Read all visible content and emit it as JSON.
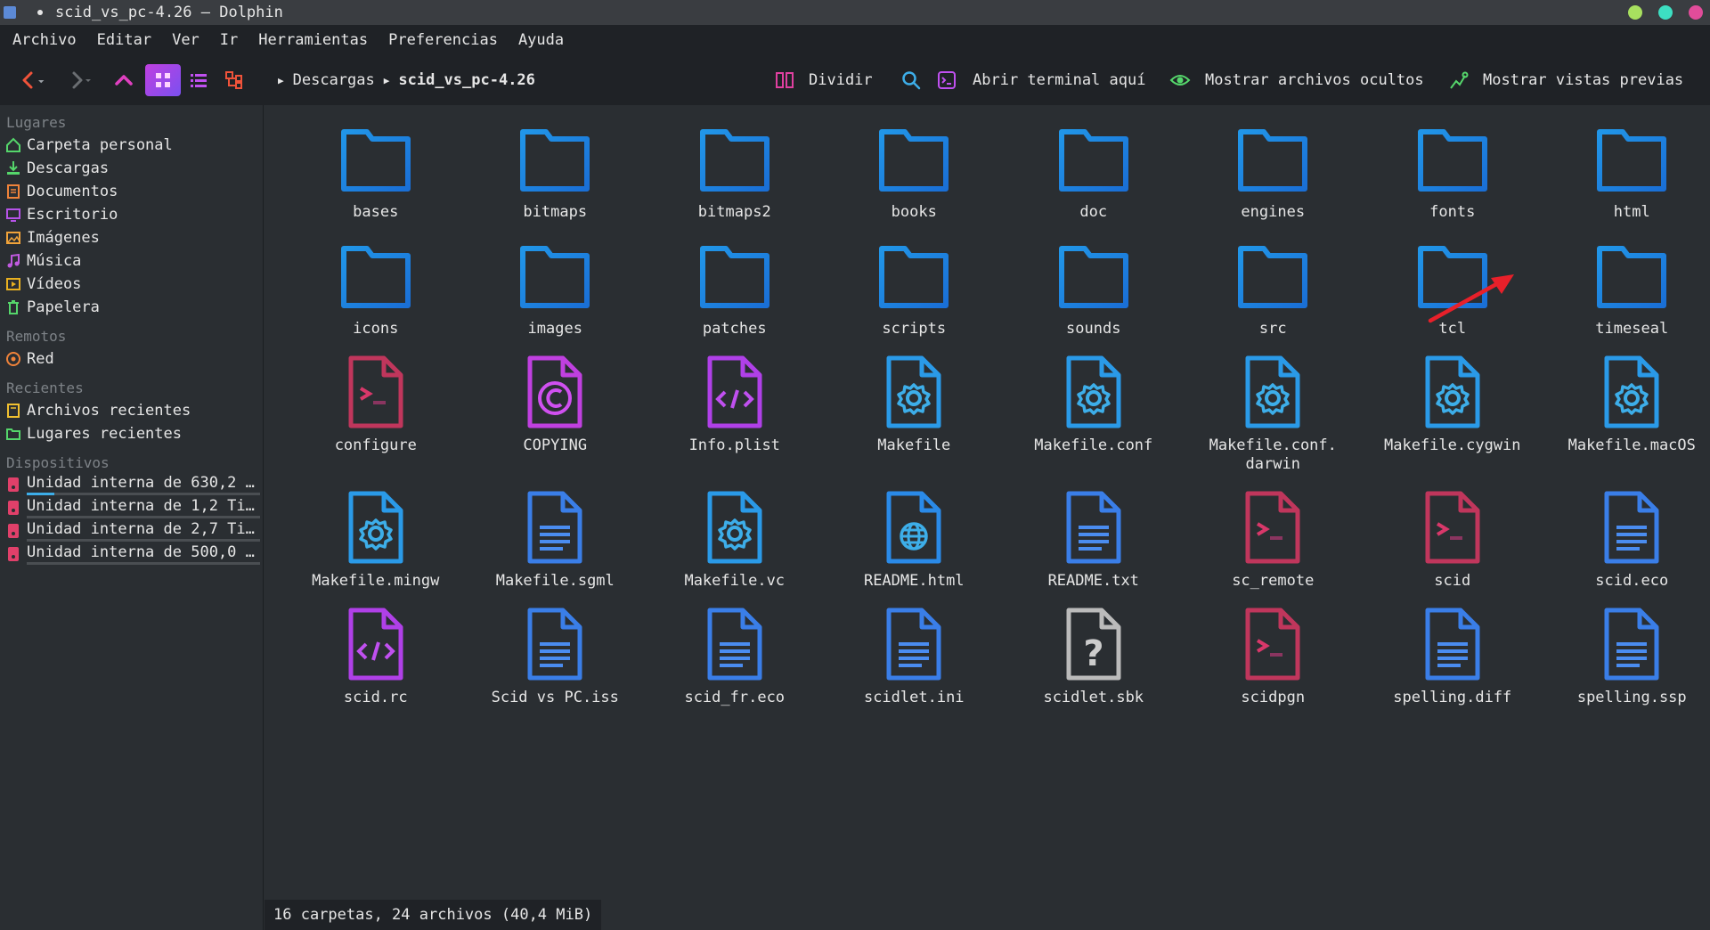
{
  "window": {
    "title": "scid_vs_pc-4.26 — Dolphin",
    "controls": [
      {
        "name": "minimize",
        "color": "#a8e05f"
      },
      {
        "name": "maximize",
        "color": "#3ddfc2"
      },
      {
        "name": "close",
        "color": "#e14c9a"
      }
    ]
  },
  "menu": [
    "Archivo",
    "Editar",
    "Ver",
    "Ir",
    "Herramientas",
    "Preferencias",
    "Ayuda"
  ],
  "toolbar": {
    "breadcrumb": [
      "Descargas",
      "scid_vs_pc-4.26"
    ],
    "split_label": "Dividir",
    "terminal_label": "Abrir terminal aquí",
    "hidden_label": "Mostrar archivos ocultos",
    "previews_label": "Mostrar vistas previas"
  },
  "sidebar": {
    "places_header": "Lugares",
    "places": [
      {
        "label": "Carpeta personal",
        "icon": "home-icon",
        "color": "#55d66b"
      },
      {
        "label": "Descargas",
        "icon": "download-icon",
        "color": "#55d66b"
      },
      {
        "label": "Documentos",
        "icon": "documents-icon",
        "color": "#f0833a"
      },
      {
        "label": "Escritorio",
        "icon": "desktop-icon",
        "color": "#b653e8"
      },
      {
        "label": "Imágenes",
        "icon": "pictures-icon",
        "color": "#f0a33a"
      },
      {
        "label": "Música",
        "icon": "music-icon",
        "color": "#c05ae0"
      },
      {
        "label": "Vídeos",
        "icon": "videos-icon",
        "color": "#e8b020"
      },
      {
        "label": "Papelera",
        "icon": "trash-icon",
        "color": "#55d66b"
      }
    ],
    "remote_header": "Remotos",
    "remote": [
      {
        "label": "Red",
        "icon": "network-icon",
        "color": "#f0833a"
      }
    ],
    "recent_header": "Recientes",
    "recent": [
      {
        "label": "Archivos recientes",
        "icon": "recent-files-icon",
        "color": "#f0c030"
      },
      {
        "label": "Lugares recientes",
        "icon": "recent-places-icon",
        "color": "#55d66b"
      }
    ],
    "devices_header": "Dispositivos",
    "devices": [
      {
        "label": "Unidad interna de 630,2 …",
        "usage": 0.12
      },
      {
        "label": "Unidad interna de 1,2 Ti…",
        "usage": 0.0
      },
      {
        "label": "Unidad interna de 2,7 Ti…",
        "usage": 0.0
      },
      {
        "label": "Unidad interna de 500,0 …",
        "usage": 0.0
      }
    ]
  },
  "files": [
    {
      "name": "bases",
      "type": "folder"
    },
    {
      "name": "bitmaps",
      "type": "folder"
    },
    {
      "name": "bitmaps2",
      "type": "folder"
    },
    {
      "name": "books",
      "type": "folder"
    },
    {
      "name": "doc",
      "type": "folder"
    },
    {
      "name": "engines",
      "type": "folder"
    },
    {
      "name": "fonts",
      "type": "folder"
    },
    {
      "name": "html",
      "type": "folder"
    },
    {
      "name": "icons",
      "type": "folder"
    },
    {
      "name": "images",
      "type": "folder"
    },
    {
      "name": "patches",
      "type": "folder"
    },
    {
      "name": "scripts",
      "type": "folder"
    },
    {
      "name": "sounds",
      "type": "folder"
    },
    {
      "name": "src",
      "type": "folder"
    },
    {
      "name": "tcl",
      "type": "folder"
    },
    {
      "name": "timeseal",
      "type": "folder"
    },
    {
      "name": "configure",
      "type": "script"
    },
    {
      "name": "COPYING",
      "type": "copyright"
    },
    {
      "name": "Info.plist",
      "type": "code"
    },
    {
      "name": "Makefile",
      "type": "config"
    },
    {
      "name": "Makefile.conf",
      "type": "config"
    },
    {
      "name": "Makefile.conf.\ndarwin",
      "type": "config"
    },
    {
      "name": "Makefile.cygwin",
      "type": "config"
    },
    {
      "name": "Makefile.macOS",
      "type": "config"
    },
    {
      "name": "Makefile.mingw",
      "type": "config"
    },
    {
      "name": "Makefile.sgml",
      "type": "text"
    },
    {
      "name": "Makefile.vc",
      "type": "config"
    },
    {
      "name": "README.html",
      "type": "html"
    },
    {
      "name": "README.txt",
      "type": "text"
    },
    {
      "name": "sc_remote",
      "type": "script"
    },
    {
      "name": "scid",
      "type": "script"
    },
    {
      "name": "scid.eco",
      "type": "text"
    },
    {
      "name": "scid.rc",
      "type": "code"
    },
    {
      "name": "Scid vs PC.iss",
      "type": "text"
    },
    {
      "name": "scid_fr.eco",
      "type": "text"
    },
    {
      "name": "scidlet.ini",
      "type": "text"
    },
    {
      "name": "scidlet.sbk",
      "type": "unknown"
    },
    {
      "name": "scidpgn",
      "type": "script"
    },
    {
      "name": "spelling.diff",
      "type": "text"
    },
    {
      "name": "spelling.ssp",
      "type": "text"
    }
  ],
  "status": "16 carpetas, 24 archivos (40,4 MiB)"
}
